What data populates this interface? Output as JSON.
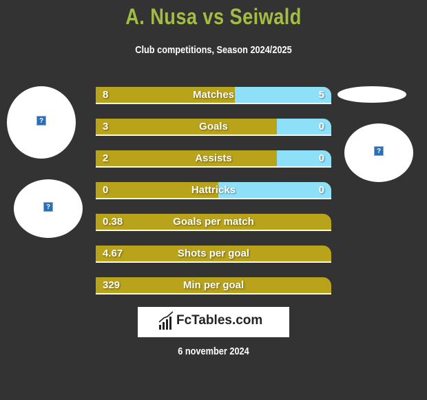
{
  "header": {
    "title": "A. Nusa vs Seiwald",
    "subtitle": "Club competitions, Season 2024/2025"
  },
  "colors": {
    "title": "#a2bc45",
    "left_bar": "#b9a31a",
    "right_bar": "#8ee0f9",
    "background": "#333333"
  },
  "stats": [
    {
      "label": "Matches",
      "left": "8",
      "right": "5",
      "left_share": 0.59
    },
    {
      "label": "Goals",
      "left": "3",
      "right": "0",
      "left_share": 0.77
    },
    {
      "label": "Assists",
      "left": "2",
      "right": "0",
      "left_share": 0.77
    },
    {
      "label": "Hattricks",
      "left": "0",
      "right": "0",
      "left_share": 0.52
    },
    {
      "label": "Goals per match",
      "left": "0.38",
      "right": "",
      "left_share": 1
    },
    {
      "label": "Shots per goal",
      "left": "4.67",
      "right": "",
      "left_share": 1
    },
    {
      "label": "Min per goal",
      "left": "329",
      "right": "",
      "left_share": 1
    }
  ],
  "icons": {
    "player_image_placeholder": "?"
  },
  "footer": {
    "logo_text": "FcTables.com",
    "date": "6 november 2024"
  }
}
